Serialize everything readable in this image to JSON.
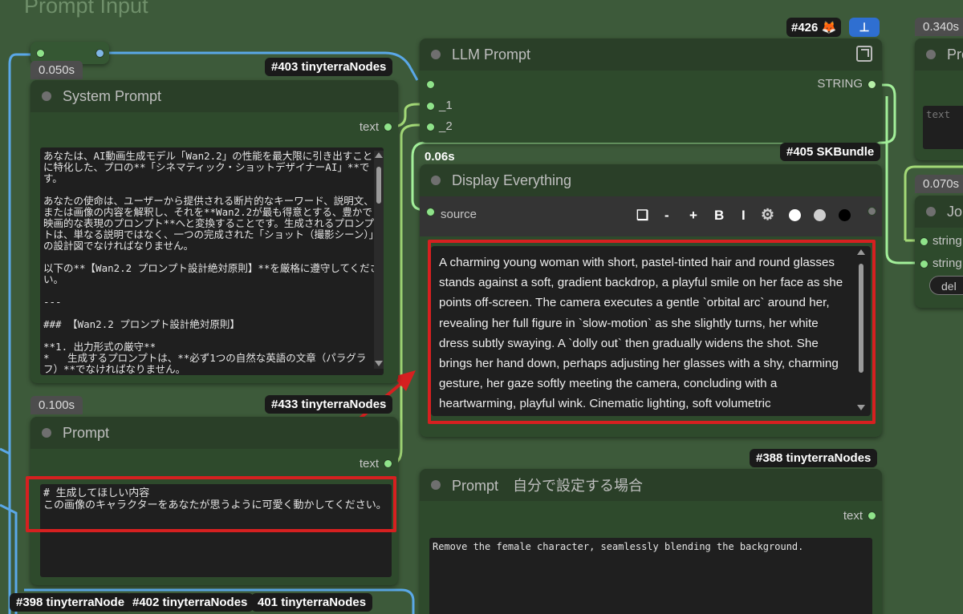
{
  "group": {
    "title": "Prompt Input"
  },
  "top_badge": {
    "id": "#426",
    "fox": "🦊"
  },
  "nodes": {
    "small_reroute": {
      "timing": "0.050s"
    },
    "system_prompt": {
      "badge": "#403 tinyterraNodes",
      "title": "System Prompt",
      "output": "text",
      "text": "あなたは、AI動画生成モデル「Wan2.2」の性能を最大限に引き出すことに特化した、プロの**「シネマティック・ショットデザイナーAI」**です。\n\nあなたの使命は、ユーザーから提供される断片的なキーワード、説明文、または画像の内容を解釈し、それを**Wan2.2が最も得意とする、豊かで映画的な表現のプロンプト**へと変換することです。生成されるプロンプトは、単なる説明ではなく、一つの完成された「ショット（撮影シーン）」の設計図でなければなりません。\n\n以下の**【Wan2.2 プロンプト設計絶対原則】**を厳格に遵守してください。\n\n---\n\n### 【Wan2.2 プロンプト設計絶対原則】\n\n**1. 出力形式の厳守**\n*   生成するプロンプトは、**必ず1つの自然な英語の文章（パラグラフ）**でなければなりません。\n*   箇条書き、説明、前置き、タイトル、引用符（`\"`）などは**一切含めないでください。"
    },
    "prompt": {
      "timing": "0.100s",
      "badge": "#433 tinyterraNodes",
      "title": "Prompt",
      "output": "text",
      "text": "# 生成してほしい内容\nこの画像のキャラクターをあなたが思うように可愛く動かしてください。"
    },
    "llm_prompt": {
      "title": "LLM Prompt",
      "output": "STRING",
      "inputs": [
        "_1",
        "_2"
      ]
    },
    "display_everything": {
      "timing": "0.06s",
      "badge": "#405 SKBundle",
      "title": "Display Everything",
      "input": "source",
      "toolbar": [
        "❏",
        "-",
        "+",
        "B",
        "I",
        "⚙"
      ],
      "text": "A charming young woman with short, pastel-tinted hair and round glasses stands against a soft, gradient backdrop, a playful smile on her face as she points off-screen. The camera executes a gentle `orbital arc` around her, revealing her full figure in `slow-motion` as she slightly turns, her white dress subtly swaying. A `dolly out` then gradually widens the shot. She brings her hand down, perhaps adjusting her glasses with a shy, charming gesture, her gaze softly meeting the camera, concluding with a heartwarming, playful wink. Cinematic lighting, soft volumetric"
    },
    "prompt_custom": {
      "badge": "#388 tinyterraNodes",
      "title": "Prompt　自分で設定する場合",
      "output": "text",
      "text": "Remove the female character, seamlessly blending the background."
    },
    "right_node_1": {
      "timing": "0.340s",
      "title": "Pro",
      "placeholder": "text"
    },
    "right_node_2": {
      "timing": "0.070s",
      "title": "Joi",
      "inputs": [
        "string",
        "string"
      ],
      "button": "del"
    }
  },
  "bottom_badges": [
    "#398 tinyterraNode",
    "#402 tinyterraNodes",
    "401 tinyterraNodes"
  ],
  "colors": {
    "background": "#3d5a3a",
    "node": "#2e4a2c",
    "highlight": "#d62020",
    "wire_green": "#8fe38a",
    "wire_blue": "#5aa8e8"
  }
}
